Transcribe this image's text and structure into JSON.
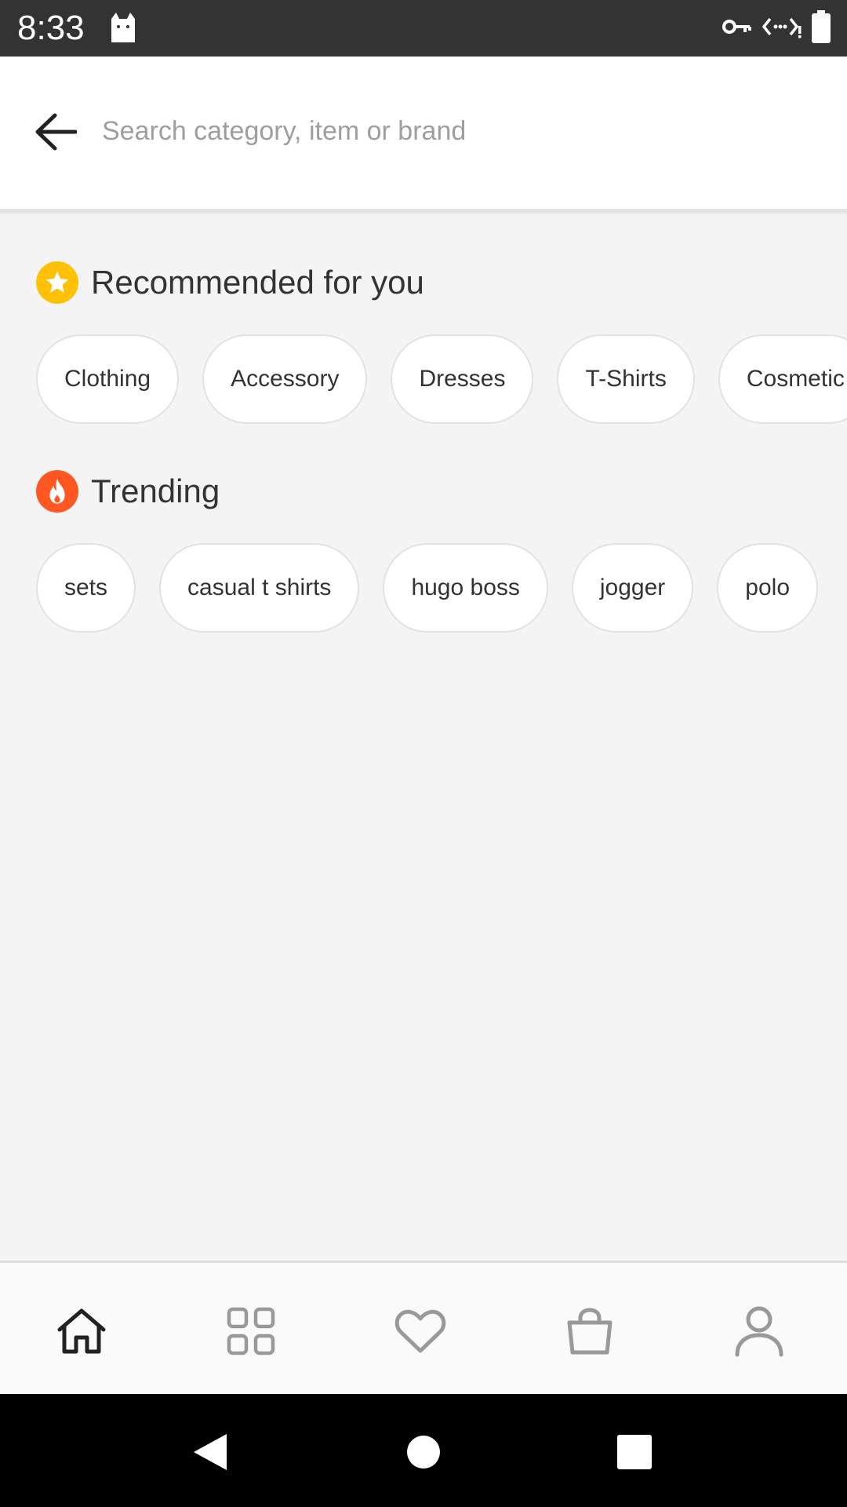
{
  "status_bar": {
    "time": "8:33",
    "icons": [
      "cat-icon",
      "vpn-key-icon",
      "data-saver-icon",
      "battery-icon"
    ]
  },
  "search": {
    "placeholder": "Search category, item or brand",
    "value": ""
  },
  "recommended": {
    "title": "Recommended for you",
    "icon": "star-icon",
    "icon_color": "#FFC107",
    "chips": [
      "Clothing",
      "Accessory",
      "Dresses",
      "T-Shirts",
      "Cosmetic"
    ]
  },
  "trending": {
    "title": "Trending",
    "icon": "fire-icon",
    "icon_color": "#FF5722",
    "chips": [
      "sets",
      "casual t shirts",
      "hugo boss",
      "jogger",
      "polo"
    ]
  },
  "bottom_nav": {
    "items": [
      "home-icon",
      "categories-icon",
      "wishlist-icon",
      "bag-icon",
      "profile-icon"
    ],
    "active": "home-icon"
  },
  "system_nav": [
    "back-icon",
    "home-circle-icon",
    "recents-icon"
  ]
}
